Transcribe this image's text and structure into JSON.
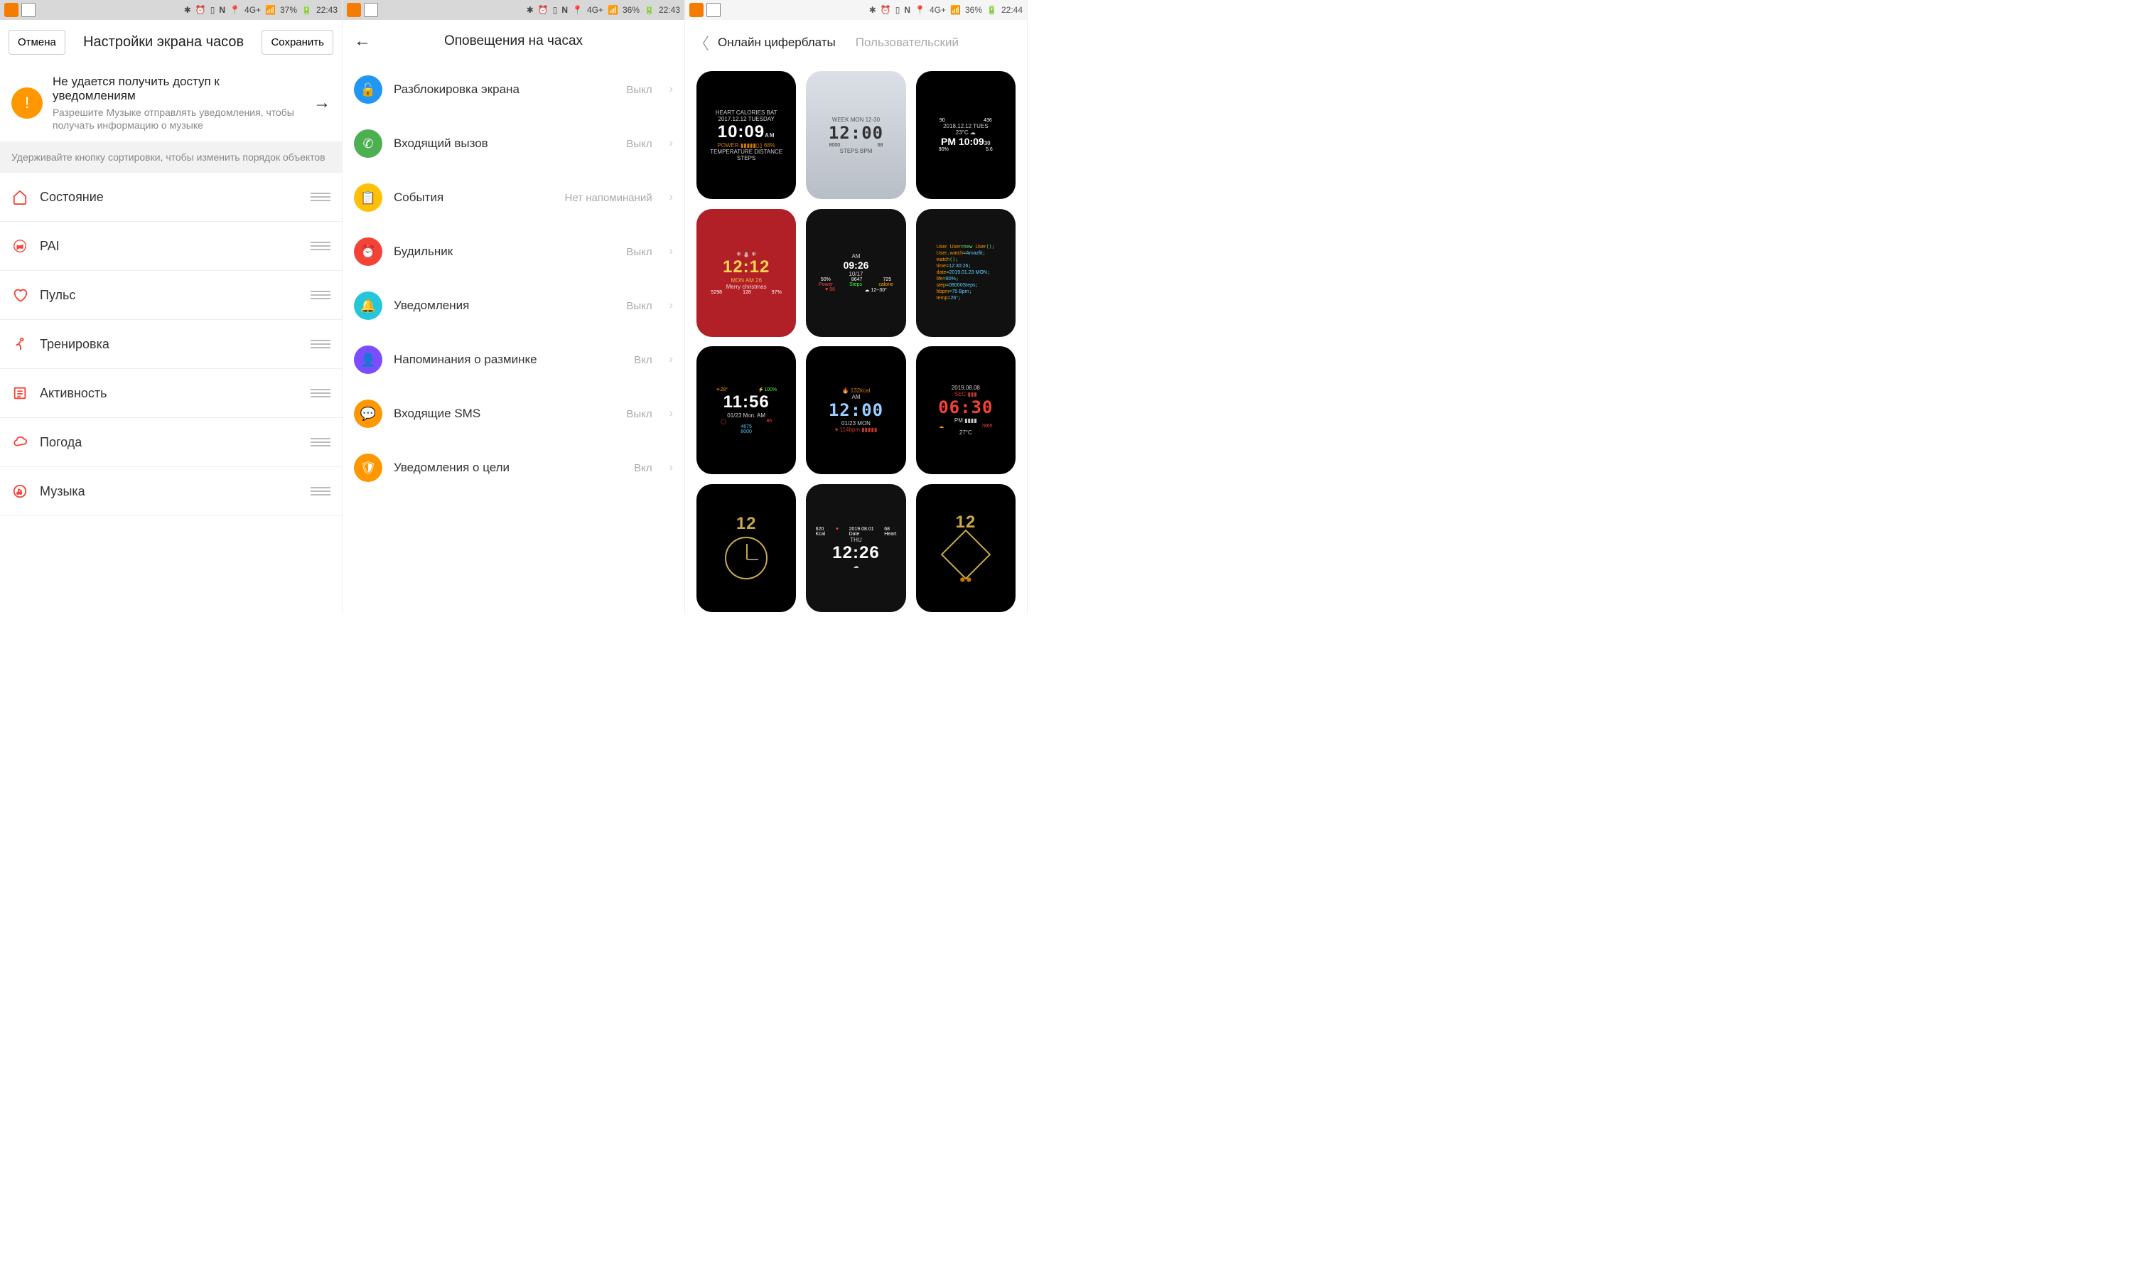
{
  "screen1": {
    "status": {
      "battery": "37%",
      "time": "22:43",
      "net": "4G+"
    },
    "cancel": "Отмена",
    "title": "Настройки экрана часов",
    "save": "Сохранить",
    "warn_title": "Не удается получить доступ к уведомлениям",
    "warn_sub": "Разрешите Музыке отправлять уведомления, чтобы получать информацию о музыке",
    "hint": "Удерживайте кнопку сортировки, чтобы изменить порядок объектов",
    "items": [
      {
        "label": "Состояние",
        "icon": "home",
        "color": "#f44336"
      },
      {
        "label": "PAI",
        "icon": "pai",
        "color": "#f44336"
      },
      {
        "label": "Пульс",
        "icon": "heart",
        "color": "#f44336"
      },
      {
        "label": "Тренировка",
        "icon": "run",
        "color": "#f44336"
      },
      {
        "label": "Активность",
        "icon": "list",
        "color": "#f44336"
      },
      {
        "label": "Погода",
        "icon": "cloud",
        "color": "#f44336"
      },
      {
        "label": "Музыка",
        "icon": "music",
        "color": "#f44336"
      }
    ]
  },
  "screen2": {
    "status": {
      "battery": "36%",
      "time": "22:43",
      "net": "4G+"
    },
    "title": "Оповещения на часах",
    "items": [
      {
        "label": "Разблокировка экрана",
        "value": "Выкл",
        "color": "#2196f3",
        "glyph": "🔓"
      },
      {
        "label": "Входящий вызов",
        "value": "Выкл",
        "color": "#4caf50",
        "glyph": "✆"
      },
      {
        "label": "События",
        "value": "Нет напоминаний",
        "color": "#ffc107",
        "glyph": "📋"
      },
      {
        "label": "Будильник",
        "value": "Выкл",
        "color": "#f44336",
        "glyph": "⏰"
      },
      {
        "label": "Уведомления",
        "value": "Выкл",
        "color": "#26c6da",
        "glyph": "🔔"
      },
      {
        "label": "Напоминания о разминке",
        "value": "Вкл",
        "color": "#7c4dff",
        "glyph": "👤"
      },
      {
        "label": "Входящие SMS",
        "value": "Выкл",
        "color": "#ff9800",
        "glyph": "💬"
      },
      {
        "label": "Уведомления о цели",
        "value": "Вкл",
        "color": "#ff9800",
        "glyph": "🛡"
      }
    ]
  },
  "screen3": {
    "status": {
      "battery": "36%",
      "time": "22:44",
      "net": "4G+"
    },
    "tab_active": "Онлайн циферблаты",
    "tab_inactive": "Пользовательский",
    "faces": [
      {
        "type": "digital-dark",
        "time": "10:09",
        "date": "2017.12.12 TUESDAY",
        "extras": "68%"
      },
      {
        "type": "silver",
        "time": "12:00",
        "date": "MON 12-30",
        "steps": "8000",
        "hr": "68"
      },
      {
        "type": "dark-rings",
        "time": "10:09",
        "date": "2018.12.12 TUES",
        "temp": "23°C",
        "pct": "90%",
        "val": "5.6",
        "top1": "90",
        "top2": "436"
      },
      {
        "type": "christmas",
        "time": "12:12",
        "date": "MON AM 26",
        "msg": "Merry christmas",
        "b1": "5298",
        "b2": "128",
        "b3": "97%"
      },
      {
        "type": "dashboard",
        "time": "09:26",
        "date": "10/17",
        "hr": "98",
        "temp": "12~30°",
        "s1": "50%",
        "s2": "8647",
        "s3": "725"
      },
      {
        "type": "code",
        "lines": "User User=new User();\\nUser.watch=Amazfit;\\nwatch();\\ntime=12:30:26;\\ndate=2019.01.23 MON;\\nlife=80%;\\nstep=08000Steps;\\nhbpm=75 Bpm;\\ntemp=26°;"
      },
      {
        "type": "rings-dark",
        "time": "11:56",
        "date": "01/23 Mon. AM",
        "temp": "28°",
        "bat": "100%",
        "hr": "86",
        "steps": "4675",
        "cal": "8000"
      },
      {
        "type": "blue-bold",
        "time": "12:00",
        "date": "01/23 MON",
        "kcal": "132kcal",
        "bpm": "114bpm"
      },
      {
        "type": "red-seg",
        "time": "06:30",
        "date": "2019.08.08",
        "temp": "27°C",
        "sub": "7865"
      },
      {
        "type": "mech-gold",
        "time": "12"
      },
      {
        "type": "center-red",
        "time": "12:26",
        "date": "2019.08.01",
        "day": "THU",
        "kcal": "620",
        "hr": "68"
      },
      {
        "type": "hex-gold",
        "time": "12"
      }
    ]
  }
}
